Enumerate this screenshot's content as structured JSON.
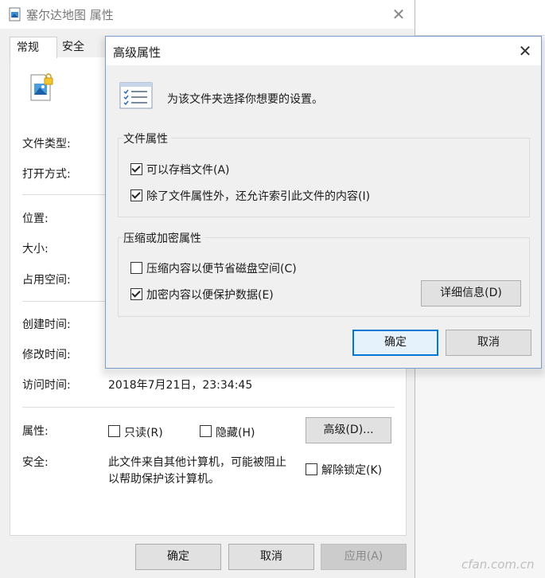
{
  "properties_window": {
    "title": "塞尔达地图 属性",
    "close_glyph": "✕",
    "tabs": [
      {
        "label": "常规"
      },
      {
        "label": "安全"
      }
    ],
    "fields": {
      "file_type_label": "文件类型:",
      "open_with_label": "打开方式:",
      "location_label": "位置:",
      "size_label": "大小:",
      "size_on_disk_label": "占用空间:",
      "created_label": "创建时间:",
      "modified_label": "修改时间:",
      "accessed_label": "访问时间:",
      "accessed_value": "2018年7月21日，23:34:45",
      "attributes_label": "属性:",
      "readonly_label": "只读(R)",
      "hidden_label": "隐藏(H)",
      "advanced_button": "高级(D)...",
      "security_label": "安全:",
      "security_text_line1": "此文件来自其他计算机，可能被阻止",
      "security_text_line2": "以帮助保护该计算机。",
      "unblock_label": "解除锁定(K)"
    },
    "buttons": {
      "ok": "确定",
      "cancel": "取消",
      "apply": "应用(A)"
    }
  },
  "advanced_dialog": {
    "title": "高级属性",
    "close_glyph": "✕",
    "description": "为该文件夹选择你想要的设置。",
    "file_attributes_group": {
      "title": "文件属性",
      "options": [
        {
          "label": "可以存档文件(A)",
          "checked": true
        },
        {
          "label": "除了文件属性外，还允许索引此文件的内容(I)",
          "checked": true
        }
      ]
    },
    "compress_encrypt_group": {
      "title": "压缩或加密属性",
      "options": [
        {
          "label": "压缩内容以便节省磁盘空间(C)",
          "checked": false
        },
        {
          "label": "加密内容以便保护数据(E)",
          "checked": true
        }
      ],
      "details_button": "详细信息(D)"
    },
    "buttons": {
      "ok": "确定",
      "cancel": "取消"
    }
  },
  "watermark": "cfan.com.cn",
  "colors": {
    "accent": "#0078d7",
    "dialog_border": "#7a9ccc"
  }
}
